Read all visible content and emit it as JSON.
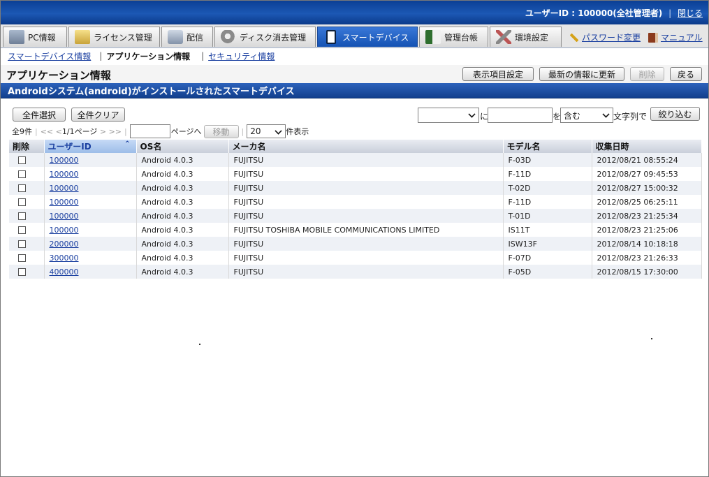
{
  "header": {
    "user_label": "ユーザーID : 100000(全社管理者)",
    "close_link": "閉じる"
  },
  "nav": {
    "tabs": [
      {
        "label": "PC情報",
        "icon": "pc-icon"
      },
      {
        "label": "ライセンス管理",
        "icon": "license-icon"
      },
      {
        "label": "配信",
        "icon": "distribution-icon"
      },
      {
        "label": "ディスク消去管理",
        "icon": "disk-icon"
      },
      {
        "label": "スマートデバイス",
        "icon": "smartphone-icon"
      },
      {
        "label": "管理台帳",
        "icon": "ledger-icon"
      },
      {
        "label": "環境設定",
        "icon": "tools-icon"
      }
    ],
    "password_link": "パスワード変更",
    "manual_link": "マニュアル"
  },
  "subnav": {
    "items": [
      "スマートデバイス情報",
      "アプリケーション情報",
      "セキュリティ情報"
    ]
  },
  "page": {
    "title": "アプリケーション情報",
    "buttons": {
      "display_settings": "表示項目設定",
      "refresh": "最新の情報に更新",
      "delete": "削除",
      "back": "戻る"
    },
    "section_title": "Androidシステム(android)がインストールされたスマートデバイス"
  },
  "controls": {
    "select_all": "全件選択",
    "clear_all": "全件クリア",
    "filter_field_value": "",
    "filter_ni": "に",
    "filter_text_value": "",
    "filter_wo": "を",
    "filter_mode": "含む",
    "filter_suffix": "文字列で",
    "filter_button": "絞り込む"
  },
  "pager": {
    "total": "全9件",
    "first": "<<",
    "prev": "<",
    "page_info": "1/1ページ",
    "next": ">",
    "last": ">>",
    "page_input": "",
    "page_to": "ページへ",
    "go_button": "移動",
    "per_page": "20",
    "per_page_suffix": "件表示"
  },
  "table": {
    "columns": [
      "削除",
      "ユーザーID",
      "OS名",
      "メーカ名",
      "モデル名",
      "収集日時"
    ],
    "rows": [
      {
        "user_id": "100000",
        "os": "Android 4.0.3",
        "maker": "FUJITSU",
        "model": "F-03D",
        "date": "2012/08/21 08:55:24"
      },
      {
        "user_id": "100000",
        "os": "Android 4.0.3",
        "maker": "FUJITSU",
        "model": "F-11D",
        "date": "2012/08/27 09:45:53"
      },
      {
        "user_id": "100000",
        "os": "Android 4.0.3",
        "maker": "FUJITSU",
        "model": "T-02D",
        "date": "2012/08/27 15:00:32"
      },
      {
        "user_id": "100000",
        "os": "Android 4.0.3",
        "maker": "FUJITSU",
        "model": "F-11D",
        "date": "2012/08/25 06:25:11"
      },
      {
        "user_id": "100000",
        "os": "Android 4.0.3",
        "maker": "FUJITSU",
        "model": "T-01D",
        "date": "2012/08/23 21:25:34"
      },
      {
        "user_id": "100000",
        "os": "Android 4.0.3",
        "maker": "FUJITSU TOSHIBA MOBILE COMMUNICATIONS LIMITED",
        "model": "IS11T",
        "date": "2012/08/23 21:25:06"
      },
      {
        "user_id": "200000",
        "os": "Android 4.0.3",
        "maker": "FUJITSU",
        "model": "ISW13F",
        "date": "2012/08/14 10:18:18"
      },
      {
        "user_id": "300000",
        "os": "Android 4.0.3",
        "maker": "FUJITSU",
        "model": "F-07D",
        "date": "2012/08/23 21:26:33"
      },
      {
        "user_id": "400000",
        "os": "Android 4.0.3",
        "maker": "FUJITSU",
        "model": "F-05D",
        "date": "2012/08/15 17:30:00"
      }
    ]
  },
  "colors": {
    "header_blue": "#1c58b4",
    "active_tab": "#1452b3",
    "link": "#1a3fa0",
    "row_alt": "#eef1f6"
  }
}
